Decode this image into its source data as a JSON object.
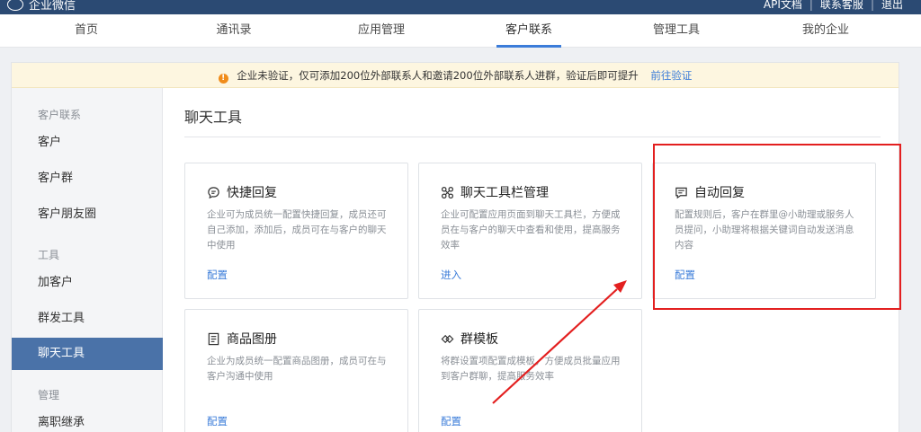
{
  "topbar": {
    "brand": "企业微信",
    "links": [
      "API文档",
      "联系客服",
      "退出"
    ],
    "separator": "|"
  },
  "nav": {
    "tabs": [
      {
        "label": "首页"
      },
      {
        "label": "通讯录"
      },
      {
        "label": "应用管理"
      },
      {
        "label": "客户联系",
        "active": true
      },
      {
        "label": "管理工具"
      },
      {
        "label": "我的企业"
      }
    ]
  },
  "notice": {
    "icon": "warning-icon",
    "text": "企业未验证，仅可添加200位外部联系人和邀请200位外部联系人进群，验证后即可提升",
    "link": "前往验证"
  },
  "sidebar": {
    "groups": [
      {
        "label": "客户联系",
        "items": [
          "客户",
          "客户群",
          "客户朋友圈"
        ]
      },
      {
        "label": "工具",
        "items": [
          "加客户",
          "群发工具",
          "聊天工具"
        ]
      },
      {
        "label": "管理",
        "items": [
          "离职继承"
        ]
      }
    ],
    "active_item": "聊天工具"
  },
  "content": {
    "title": "聊天工具",
    "cards": [
      {
        "icon": "message-bubble-icon",
        "title": "快捷回复",
        "desc": "企业可为成员统一配置快捷回复，成员还可自己添加，添加后，成员可在与客户的聊天中使用",
        "link": "配置"
      },
      {
        "icon": "toolbar-tools-icon",
        "title": "聊天工具栏管理",
        "desc": "企业可配置应用页面到聊天工具栏，方便成员在与客户的聊天中查看和使用，提高服务效率",
        "link": "进入"
      },
      {
        "icon": "auto-reply-icon",
        "title": "自动回复",
        "desc": "配置规则后，客户在群里@小助理或服务人员提问，小助理将根据关键词自动发送消息内容",
        "link": "配置"
      },
      {
        "icon": "product-album-icon",
        "title": "商品图册",
        "desc": "企业为成员统一配置商品图册，成员可在与客户沟通中使用",
        "link": "配置"
      },
      {
        "icon": "group-template-icon",
        "title": "群模板",
        "desc": "将群设置项配置成模板，方便成员批量应用到客户群聊，提高服务效率",
        "link": "配置"
      }
    ]
  },
  "annotation": {
    "highlight_color": "#e31f1f"
  }
}
